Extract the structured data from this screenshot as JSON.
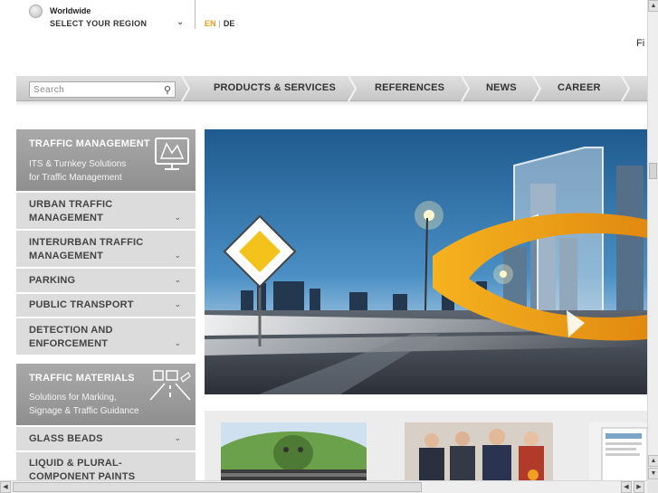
{
  "region": {
    "title": "Worldwide",
    "select_label": "SELECT YOUR REGION"
  },
  "languages": {
    "en": "EN",
    "de": "DE",
    "separator": "|"
  },
  "cut_text": "Fi",
  "search": {
    "placeholder": "Search"
  },
  "nav": {
    "items": [
      "PRODUCTS & SERVICES",
      "REFERENCES",
      "NEWS",
      "CAREER"
    ]
  },
  "sidebar": {
    "traffic_management": {
      "title": "TRAFFIC MANAGEMENT",
      "desc1": "ITS & Turnkey Solutions",
      "desc2": "for Traffic Management",
      "items": [
        {
          "line1": "URBAN TRAFFIC",
          "line2": "MANAGEMENT"
        },
        {
          "line1": "INTERURBAN TRAFFIC",
          "line2": "MANAGEMENT"
        },
        {
          "line1": "PARKING",
          "line2": ""
        },
        {
          "line1": "PUBLIC TRANSPORT",
          "line2": ""
        },
        {
          "line1": "DETECTION AND",
          "line2": "ENFORCEMENT"
        }
      ]
    },
    "traffic_materials": {
      "title": "TRAFFIC MATERIALS",
      "desc1": "Solutions for Marking,",
      "desc2": "Signage & Traffic Guidance",
      "items": [
        {
          "line1": "GLASS BEADS",
          "line2": ""
        },
        {
          "line1": "LIQUID & PLURAL-",
          "line2": "COMPONENT PAINTS"
        }
      ]
    }
  },
  "colors": {
    "accent": "#e89c1e",
    "sidebar_head": "#999999",
    "sidebar_item": "#dcdcdc",
    "sky": "#2d6fa6"
  },
  "icons": [
    "globe-icon",
    "chevron-down-icon",
    "search-icon",
    "monitor-map-icon",
    "road-marking-icon"
  ]
}
